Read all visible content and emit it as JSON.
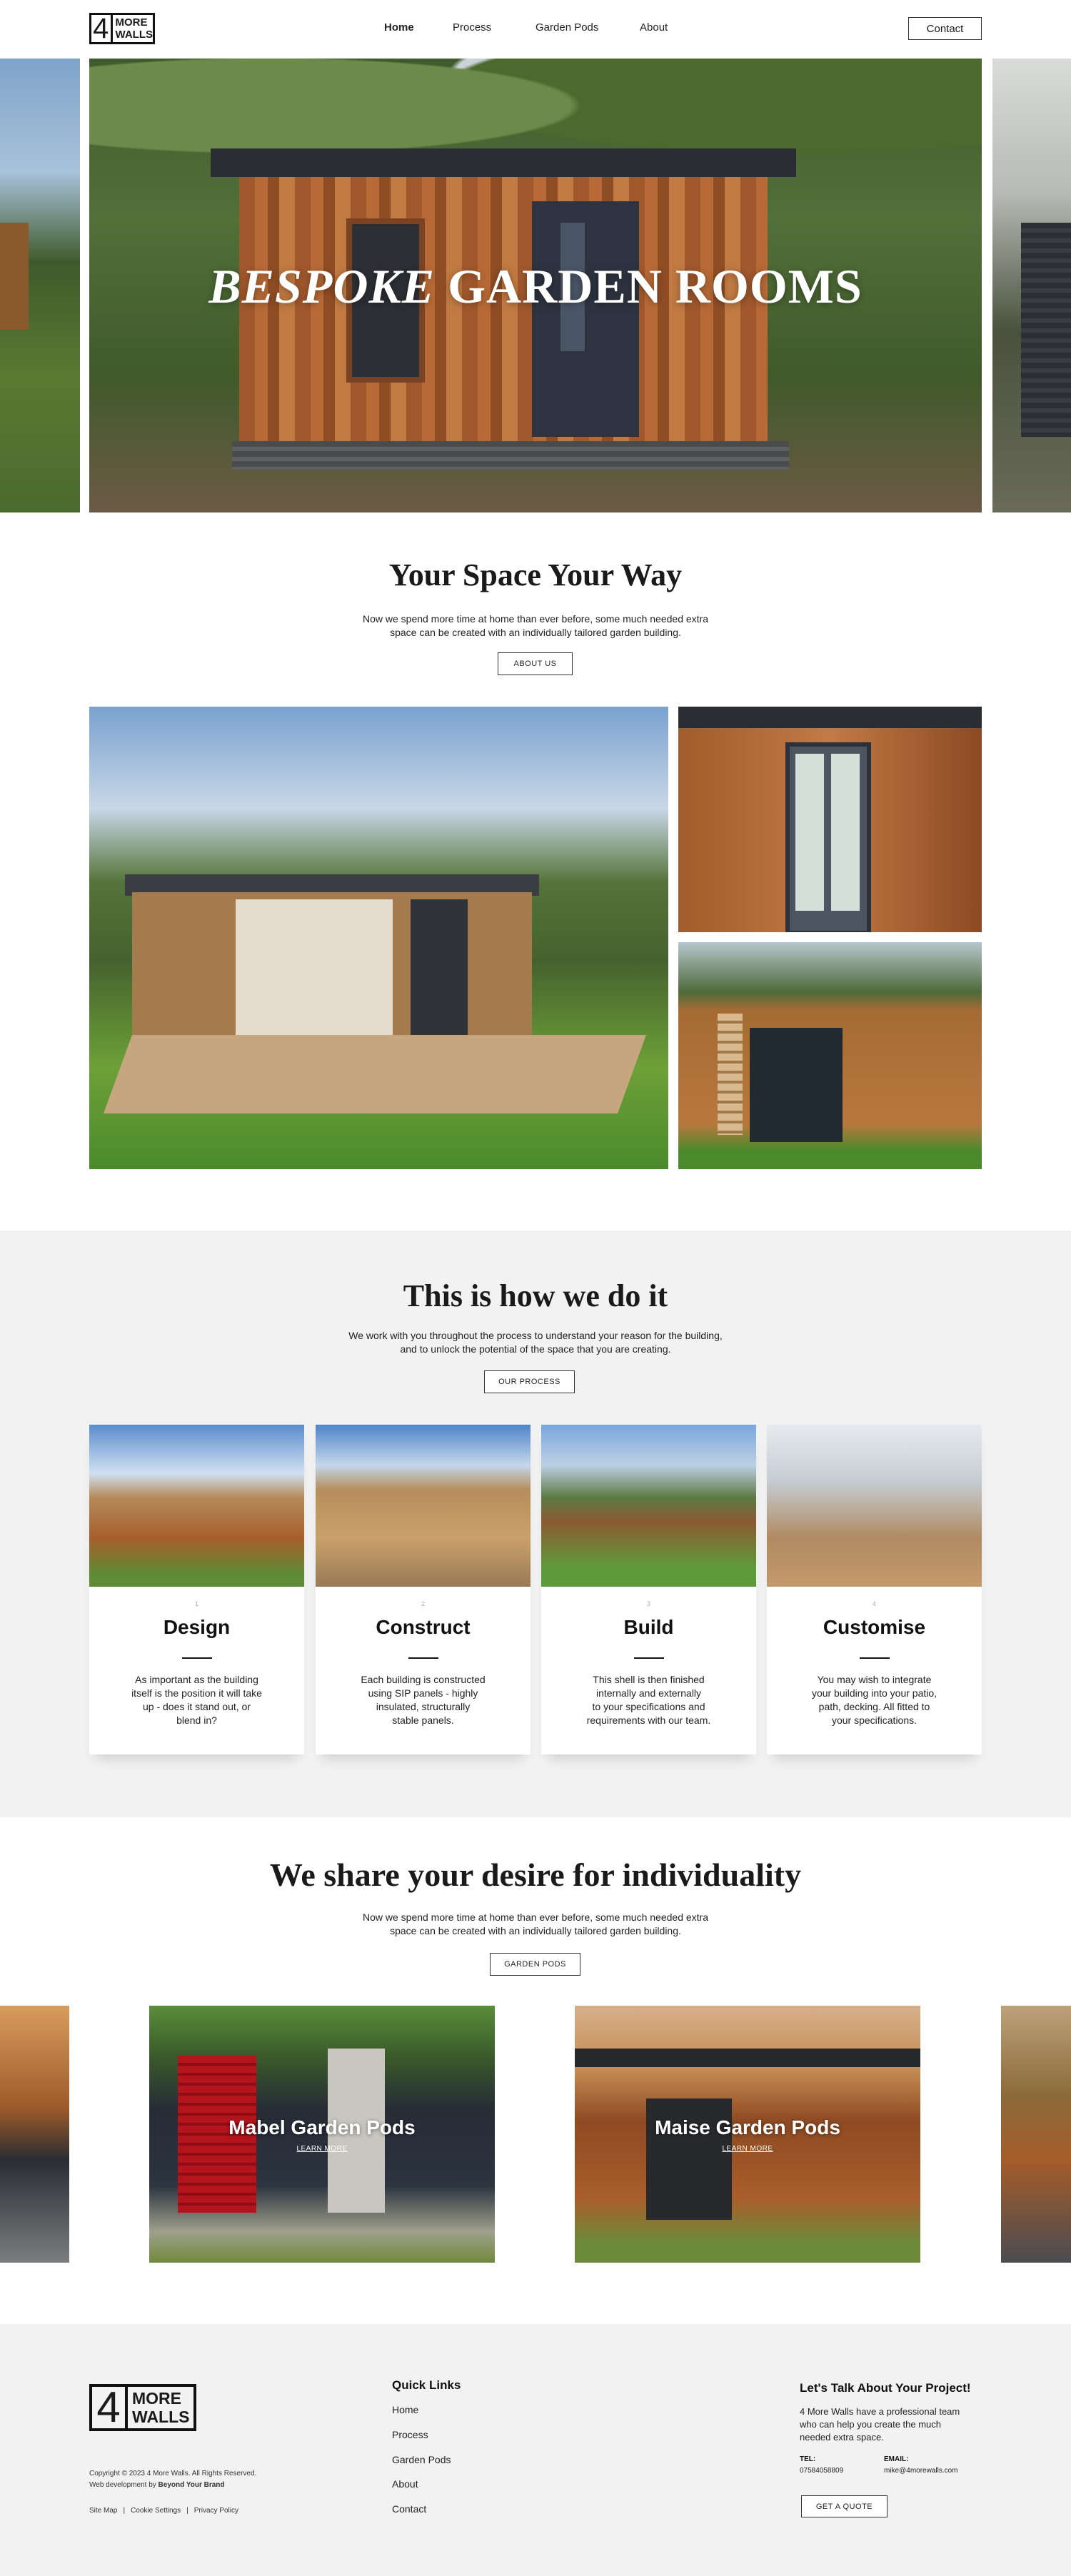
{
  "header": {
    "logo": {
      "four": "4",
      "line1": "MORE",
      "line2": "WALLS"
    },
    "nav": [
      "Home",
      "Process",
      "Garden Pods",
      "About"
    ],
    "contact_label": "Contact"
  },
  "hero": {
    "title_italic": "BESPOKE",
    "title_rest": " GARDEN ROOMS"
  },
  "space": {
    "title": "Your Space Your Way",
    "text_line1": "Now we spend more time at home than ever before, some much needed extra",
    "text_line2": "space can be created with an individually tailored garden building.",
    "button": "ABOUT US"
  },
  "process": {
    "title": "This is how we do it",
    "text_line1": "We work with you throughout the process to understand your reason for the building,",
    "text_line2": "and to unlock the potential of the space that you are creating.",
    "button": "OUR PROCESS",
    "cards": [
      {
        "num": "1",
        "title": "Design",
        "lines": [
          "As important as the building",
          "itself is the position it will take",
          "up - does it stand out, or",
          "blend in?"
        ]
      },
      {
        "num": "2",
        "title": "Construct",
        "lines": [
          "Each building is constructed",
          "using SIP panels - highly",
          "insulated, structurally",
          "stable panels."
        ]
      },
      {
        "num": "3",
        "title": "Build",
        "lines": [
          "This shell is then finished",
          "internally and externally",
          "to your specifications and",
          "requirements with our team."
        ]
      },
      {
        "num": "4",
        "title": "Customise",
        "lines": [
          "You may wish to integrate",
          "your building into your patio,",
          "path, decking. All fitted to",
          "your specifications."
        ]
      }
    ]
  },
  "individuality": {
    "title": "We share your desire for individuality",
    "text_line1": "Now we spend more time at home than ever before, some much needed extra",
    "text_line2": "space can be created with an individually tailored garden building.",
    "button": "GARDEN PODS",
    "pods": [
      {
        "name": "Mabel Garden Pods",
        "link": "LEARN MORE"
      },
      {
        "name": "Maise Garden Pods",
        "link": "LEARN MORE"
      }
    ]
  },
  "footer": {
    "copyright": "Copyright © 2023 4 More Walls. All Rights Reserved.",
    "webdev_prefix": "Web development by ",
    "webdev_brand": "Beyond Your Brand",
    "legal": [
      "Site Map",
      "Cookie Settings",
      "Privacy Policy"
    ],
    "legal_sep": "|",
    "quick_links_title": "Quick Links",
    "quick_links": [
      "Home",
      "Process",
      "Garden Pods",
      "About",
      "Contact"
    ],
    "cta_title": "Let's Talk About Your Project!",
    "cta_text": "4 More Walls have a professional team who can help you create the much needed extra space.",
    "tel_label": "TEL:",
    "tel": "07584058809",
    "email_label": "EMAIL:",
    "email": "mike@4morewalls.com",
    "quote_button": "GET A QUOTE"
  },
  "colors": {
    "accent": "#111111",
    "section_bg": "#f2f2f2",
    "page_bg": "#ffffff"
  }
}
